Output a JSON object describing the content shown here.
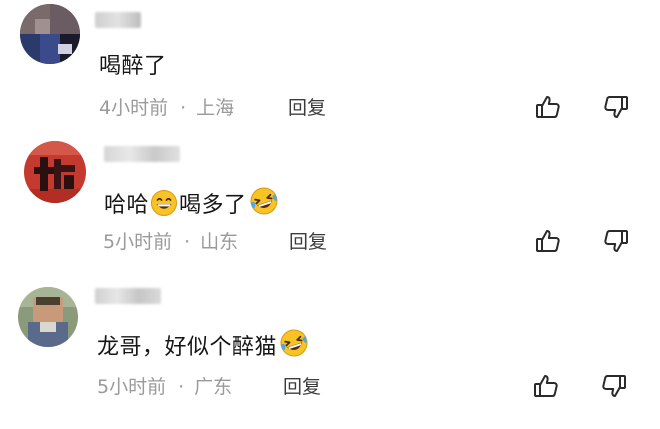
{
  "comments": [
    {
      "text": "喝醉了",
      "emojis": [],
      "time": "4小时前",
      "separator": "·",
      "location": "上海",
      "reply_label": "回复",
      "like_icon": "thumbs-up-icon",
      "dislike_icon": "thumbs-down-icon"
    },
    {
      "text_parts": [
        "哈哈",
        "喝多了"
      ],
      "emojis": [
        "grinning-face-emoji",
        "rolling-laughing-face-emoji"
      ],
      "time": "5小时前",
      "separator": "·",
      "location": "山东",
      "reply_label": "回复",
      "like_icon": "thumbs-up-icon",
      "dislike_icon": "thumbs-down-icon"
    },
    {
      "text": "龙哥，好似个醉猫",
      "emojis": [
        "rolling-laughing-face-emoji"
      ],
      "time": "5小时前",
      "separator": "·",
      "location": "广东",
      "reply_label": "回复",
      "like_icon": "thumbs-up-icon",
      "dislike_icon": "thumbs-down-icon"
    }
  ],
  "colors": {
    "text": "#161616",
    "meta": "#9a9a9a",
    "reply": "#3c3c3c",
    "icon": "#2a2a2a",
    "emoji_face": "#f7c325"
  }
}
